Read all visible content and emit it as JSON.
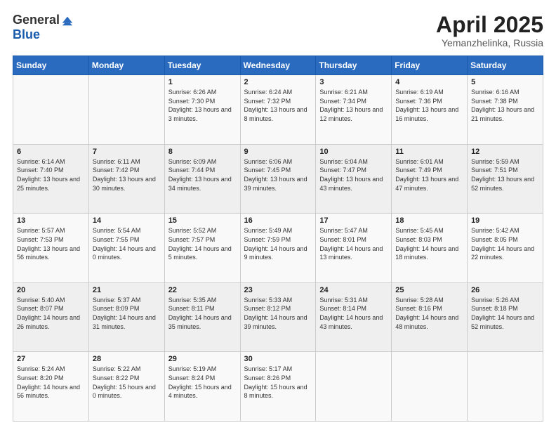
{
  "logo": {
    "general": "General",
    "blue": "Blue"
  },
  "title": "April 2025",
  "subtitle": "Yemanzhelinka, Russia",
  "days_of_week": [
    "Sunday",
    "Monday",
    "Tuesday",
    "Wednesday",
    "Thursday",
    "Friday",
    "Saturday"
  ],
  "weeks": [
    [
      {
        "day": "",
        "info": ""
      },
      {
        "day": "",
        "info": ""
      },
      {
        "day": "1",
        "info": "Sunrise: 6:26 AM\nSunset: 7:30 PM\nDaylight: 13 hours and 3 minutes."
      },
      {
        "day": "2",
        "info": "Sunrise: 6:24 AM\nSunset: 7:32 PM\nDaylight: 13 hours and 8 minutes."
      },
      {
        "day": "3",
        "info": "Sunrise: 6:21 AM\nSunset: 7:34 PM\nDaylight: 13 hours and 12 minutes."
      },
      {
        "day": "4",
        "info": "Sunrise: 6:19 AM\nSunset: 7:36 PM\nDaylight: 13 hours and 16 minutes."
      },
      {
        "day": "5",
        "info": "Sunrise: 6:16 AM\nSunset: 7:38 PM\nDaylight: 13 hours and 21 minutes."
      }
    ],
    [
      {
        "day": "6",
        "info": "Sunrise: 6:14 AM\nSunset: 7:40 PM\nDaylight: 13 hours and 25 minutes."
      },
      {
        "day": "7",
        "info": "Sunrise: 6:11 AM\nSunset: 7:42 PM\nDaylight: 13 hours and 30 minutes."
      },
      {
        "day": "8",
        "info": "Sunrise: 6:09 AM\nSunset: 7:44 PM\nDaylight: 13 hours and 34 minutes."
      },
      {
        "day": "9",
        "info": "Sunrise: 6:06 AM\nSunset: 7:45 PM\nDaylight: 13 hours and 39 minutes."
      },
      {
        "day": "10",
        "info": "Sunrise: 6:04 AM\nSunset: 7:47 PM\nDaylight: 13 hours and 43 minutes."
      },
      {
        "day": "11",
        "info": "Sunrise: 6:01 AM\nSunset: 7:49 PM\nDaylight: 13 hours and 47 minutes."
      },
      {
        "day": "12",
        "info": "Sunrise: 5:59 AM\nSunset: 7:51 PM\nDaylight: 13 hours and 52 minutes."
      }
    ],
    [
      {
        "day": "13",
        "info": "Sunrise: 5:57 AM\nSunset: 7:53 PM\nDaylight: 13 hours and 56 minutes."
      },
      {
        "day": "14",
        "info": "Sunrise: 5:54 AM\nSunset: 7:55 PM\nDaylight: 14 hours and 0 minutes."
      },
      {
        "day": "15",
        "info": "Sunrise: 5:52 AM\nSunset: 7:57 PM\nDaylight: 14 hours and 5 minutes."
      },
      {
        "day": "16",
        "info": "Sunrise: 5:49 AM\nSunset: 7:59 PM\nDaylight: 14 hours and 9 minutes."
      },
      {
        "day": "17",
        "info": "Sunrise: 5:47 AM\nSunset: 8:01 PM\nDaylight: 14 hours and 13 minutes."
      },
      {
        "day": "18",
        "info": "Sunrise: 5:45 AM\nSunset: 8:03 PM\nDaylight: 14 hours and 18 minutes."
      },
      {
        "day": "19",
        "info": "Sunrise: 5:42 AM\nSunset: 8:05 PM\nDaylight: 14 hours and 22 minutes."
      }
    ],
    [
      {
        "day": "20",
        "info": "Sunrise: 5:40 AM\nSunset: 8:07 PM\nDaylight: 14 hours and 26 minutes."
      },
      {
        "day": "21",
        "info": "Sunrise: 5:37 AM\nSunset: 8:09 PM\nDaylight: 14 hours and 31 minutes."
      },
      {
        "day": "22",
        "info": "Sunrise: 5:35 AM\nSunset: 8:11 PM\nDaylight: 14 hours and 35 minutes."
      },
      {
        "day": "23",
        "info": "Sunrise: 5:33 AM\nSunset: 8:12 PM\nDaylight: 14 hours and 39 minutes."
      },
      {
        "day": "24",
        "info": "Sunrise: 5:31 AM\nSunset: 8:14 PM\nDaylight: 14 hours and 43 minutes."
      },
      {
        "day": "25",
        "info": "Sunrise: 5:28 AM\nSunset: 8:16 PM\nDaylight: 14 hours and 48 minutes."
      },
      {
        "day": "26",
        "info": "Sunrise: 5:26 AM\nSunset: 8:18 PM\nDaylight: 14 hours and 52 minutes."
      }
    ],
    [
      {
        "day": "27",
        "info": "Sunrise: 5:24 AM\nSunset: 8:20 PM\nDaylight: 14 hours and 56 minutes."
      },
      {
        "day": "28",
        "info": "Sunrise: 5:22 AM\nSunset: 8:22 PM\nDaylight: 15 hours and 0 minutes."
      },
      {
        "day": "29",
        "info": "Sunrise: 5:19 AM\nSunset: 8:24 PM\nDaylight: 15 hours and 4 minutes."
      },
      {
        "day": "30",
        "info": "Sunrise: 5:17 AM\nSunset: 8:26 PM\nDaylight: 15 hours and 8 minutes."
      },
      {
        "day": "",
        "info": ""
      },
      {
        "day": "",
        "info": ""
      },
      {
        "day": "",
        "info": ""
      }
    ]
  ]
}
